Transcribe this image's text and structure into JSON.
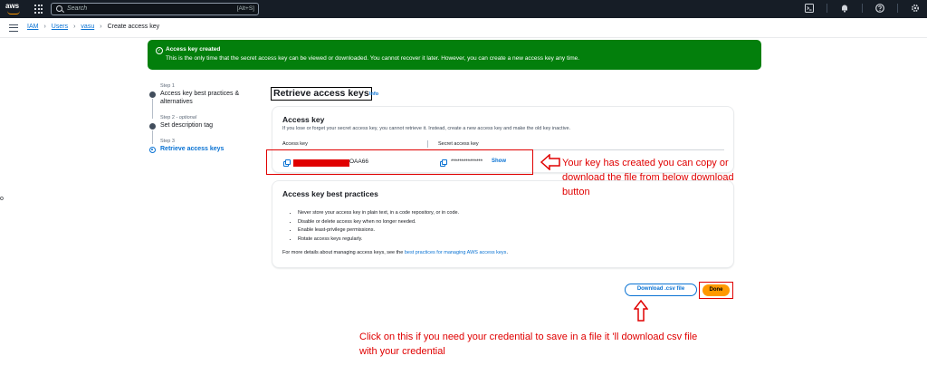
{
  "topbar": {
    "logo": "aws",
    "search_placeholder": "Search",
    "search_shortcut": "[Alt+S]",
    "icons": [
      "cloudshell-icon",
      "bell-icon",
      "help-icon",
      "settings-icon"
    ]
  },
  "breadcrumb": {
    "items": [
      "IAM",
      "Users",
      "vasu"
    ],
    "current": "Create access key"
  },
  "flash": {
    "title": "Access key created",
    "message": "This is the only time that the secret access key can be viewed or downloaded. You cannot recover it later. However, you can create a new access key any time."
  },
  "steps": [
    {
      "number": "Step 1",
      "optional": "",
      "label": "Access key best practices & alternatives"
    },
    {
      "number": "Step 2",
      "optional": "- optional",
      "label": "Set description tag"
    },
    {
      "number": "Step 3",
      "optional": "",
      "label": "Retrieve access keys"
    }
  ],
  "page": {
    "title": "Retrieve access keys",
    "info": "Info"
  },
  "access_key_panel": {
    "heading": "Access key",
    "description": "If you lose or forget your secret access key, you cannot retrieve it. Instead, create a new access key and make the old key inactive.",
    "col_access_key": "Access key",
    "col_secret_key": "Secret access key",
    "access_key_suffix": "OAA66",
    "secret_mask": "***************",
    "show_label": "Show"
  },
  "best_practices_panel": {
    "heading": "Access key best practices",
    "items": [
      "Never store your access key in plain text, in a code repository, or in code.",
      "Disable or delete access key when no longer needed.",
      "Enable least-privilege permissions.",
      "Rotate access keys regularly."
    ],
    "more_prefix": "For more details about managing access keys, see the ",
    "more_link": "best practices for managing AWS access keys",
    "more_suffix": "."
  },
  "actions": {
    "download_label": "Download .csv file",
    "done_label": "Done"
  },
  "annotations": {
    "note_key": "Your key has created you can copy or download the file from below download button",
    "note_download": "Click on this if you need your credential to save in a file it 'll download csv file with your credential",
    "edge_glyph": "o"
  },
  "colors": {
    "accent": "#0972d3",
    "success": "#037f0c",
    "primary_button": "#ff9900",
    "annotation_red": "#e00000",
    "topbar": "#161d26"
  }
}
